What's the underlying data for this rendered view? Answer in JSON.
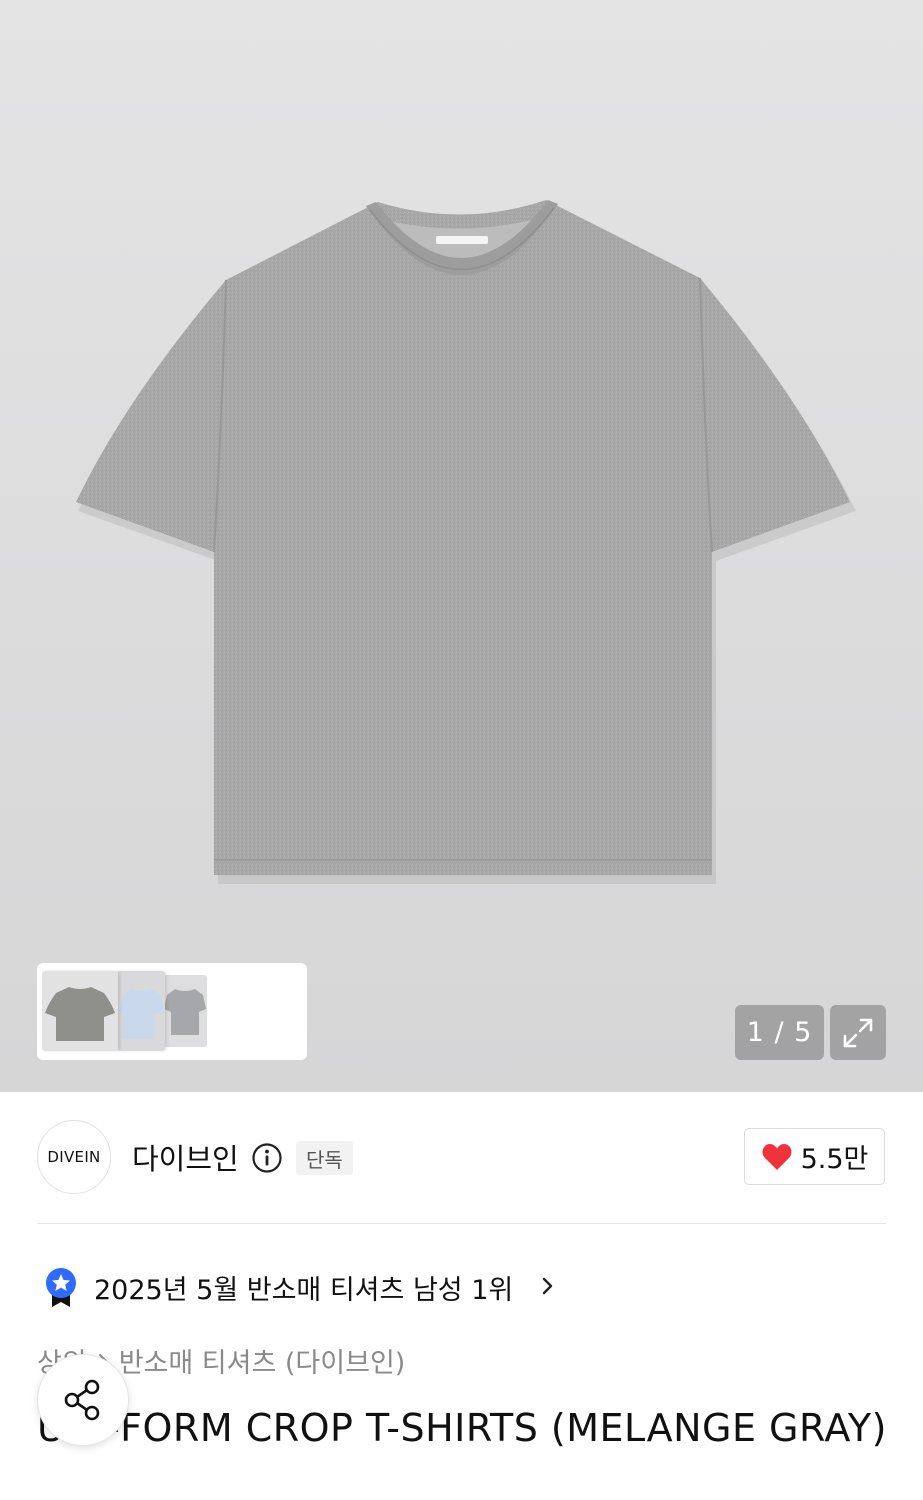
{
  "gallery": {
    "counter": "1 / 5",
    "expand_icon": "expand-arrows-icon"
  },
  "brand": {
    "logo_text": "DIVEIN",
    "name": "다이브인",
    "info_icon": "info-circle-icon",
    "exclusive_badge": "단독"
  },
  "likes": {
    "icon": "heart-icon",
    "count": "5.5만",
    "heart_color": "#f0323c"
  },
  "ranking": {
    "icon": "star-badge-icon",
    "text": "2025년 5월 반소매 티셔츠 남성 1위"
  },
  "breadcrumb": {
    "items": [
      "상의",
      "반소매 티셔츠 (다이브인)"
    ]
  },
  "product": {
    "title": "UNI-FORM CROP T-SHIRTS (MELANGE GRAY)"
  },
  "share": {
    "icon": "share-icon"
  }
}
